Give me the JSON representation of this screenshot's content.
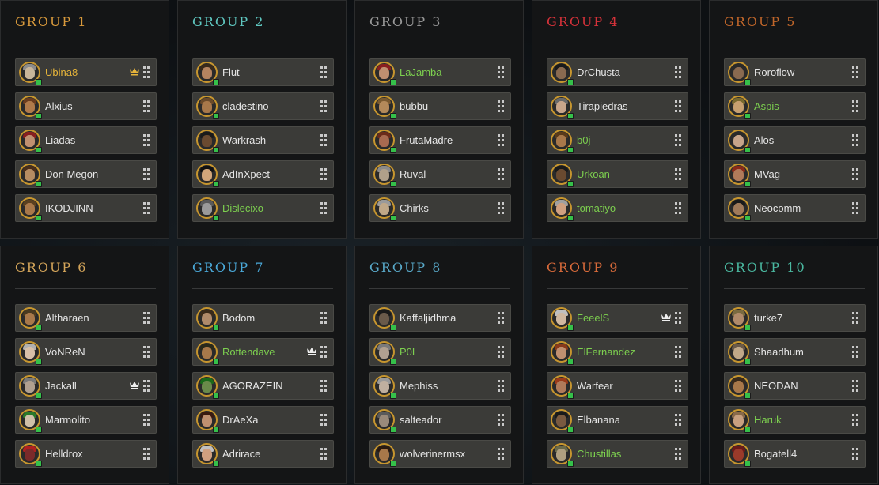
{
  "groups": [
    {
      "title": "GROUP 1",
      "color": "#d99a3c",
      "players": [
        {
          "name": "Ubina8",
          "name_color": "gold",
          "leader": true,
          "skin": "#c8b59a",
          "hair": "#8c8c8c",
          "ring": "#c7962f"
        },
        {
          "name": "Alxius",
          "skin": "#b07a4a",
          "hair": "#6b3d1f",
          "ring": "#c7962f"
        },
        {
          "name": "Liadas",
          "skin": "#c09070",
          "hair": "#8a1f1f",
          "ring": "#c7962f"
        },
        {
          "name": "Don Megon",
          "skin": "#b58c62",
          "hair": "#4a2e1a",
          "ring": "#c7962f"
        },
        {
          "name": "IKODJINN",
          "skin": "#a8784a",
          "hair": "#5a4020",
          "ring": "#c7962f"
        }
      ]
    },
    {
      "title": "GROUP 2",
      "color": "#5fc7c0",
      "players": [
        {
          "name": "Flut",
          "skin": "#b58460",
          "hair": "#3a2a1a",
          "ring": "#c7962f"
        },
        {
          "name": "cladestino",
          "skin": "#a8784a",
          "hair": "#6a4a2a",
          "ring": "#c7962f"
        },
        {
          "name": "Warkrash",
          "skin": "#6a4a30",
          "hair": "#1a1a1a",
          "ring": "#c7962f"
        },
        {
          "name": "AdInXpect",
          "skin": "#d2a67a",
          "hair": "#111111",
          "ring": "#c7962f"
        },
        {
          "name": "Dislecixo",
          "name_color": "green",
          "skin": "#9a9a9a",
          "hair": "#5a5a5a",
          "ring": "#c7962f"
        }
      ]
    },
    {
      "title": "GROUP 3",
      "color": "#9a9a9a",
      "players": [
        {
          "name": "LaJamba",
          "name_color": "green",
          "skin": "#c09070",
          "hair": "#8a1f1f",
          "ring": "#c7962f"
        },
        {
          "name": "bubbu",
          "skin": "#b48a5a",
          "hair": "#7a5a30",
          "ring": "#c7962f"
        },
        {
          "name": "FrutaMadre",
          "skin": "#a86a50",
          "hair": "#6a2a1a",
          "ring": "#c7962f"
        },
        {
          "name": "Ruval",
          "skin": "#b0a08a",
          "hair": "#8a8a8a",
          "ring": "#c7962f"
        },
        {
          "name": "Chirks",
          "skin": "#c0a888",
          "hair": "#9a9a9a",
          "ring": "#c7962f"
        }
      ]
    },
    {
      "title": "GROUP 4",
      "color": "#d8323a",
      "players": [
        {
          "name": "DrChusta",
          "skin": "#8a6a50",
          "hair": "#1a1a1a",
          "ring": "#c7962f"
        },
        {
          "name": "Tirapiedras",
          "skin": "#c8a58a",
          "hair": "#6a6a6a",
          "ring": "#c7962f"
        },
        {
          "name": "b0j",
          "name_color": "green",
          "skin": "#a8784a",
          "hair": "#5a3a1a",
          "ring": "#c7962f"
        },
        {
          "name": "Urkoan",
          "name_color": "green",
          "skin": "#6a4a30",
          "hair": "#1a1a1a",
          "ring": "#c7962f"
        },
        {
          "name": "tomatiyo",
          "name_color": "green",
          "skin": "#d0a080",
          "hair": "#a0a0a0",
          "ring": "#c7962f"
        }
      ]
    },
    {
      "title": "GROUP 5",
      "color": "#c0662a",
      "players": [
        {
          "name": "Roroflow",
          "skin": "#8a6a50",
          "hair": "#2a2a2a",
          "ring": "#c7962f"
        },
        {
          "name": "Aspis",
          "name_color": "green",
          "skin": "#c8a070",
          "hair": "#7a6a30",
          "ring": "#c7962f"
        },
        {
          "name": "Alos",
          "skin": "#c8a58a",
          "hair": "#2a2a2a",
          "ring": "#c7962f"
        },
        {
          "name": "MVag",
          "skin": "#b07a5a",
          "hair": "#8a2a1a",
          "ring": "#c7962f"
        },
        {
          "name": "Neocomm",
          "skin": "#a07a5a",
          "hair": "#1a1a1a",
          "ring": "#c7962f"
        }
      ]
    },
    {
      "title": "GROUP 6",
      "color": "#d4a55a",
      "players": [
        {
          "name": "Altharaen",
          "skin": "#a8784a",
          "hair": "#4a3a20",
          "ring": "#c7962f"
        },
        {
          "name": "VoNReN",
          "skin": "#d8c0a8",
          "hair": "#b0b0b0",
          "ring": "#c7962f"
        },
        {
          "name": "Jackall",
          "leader": true,
          "skin": "#b0a090",
          "hair": "#7a7a7a",
          "ring": "#c7962f"
        },
        {
          "name": "Marmolito",
          "skin": "#d0c0a8",
          "hair": "#2a7a2a",
          "ring": "#c7962f"
        },
        {
          "name": "Helldrox",
          "skin": "#7a2a2a",
          "hair": "#b02020",
          "ring": "#c7962f"
        }
      ]
    },
    {
      "title": "GROUP 7",
      "color": "#4aa8d8",
      "players": [
        {
          "name": "Bodom",
          "skin": "#b08a6a",
          "hair": "#3a2a1a",
          "ring": "#c7962f"
        },
        {
          "name": "Rottendave",
          "name_color": "green",
          "leader": true,
          "skin": "#a8784a",
          "hair": "#2a2a1a",
          "ring": "#c7962f"
        },
        {
          "name": "AGORAZEIN",
          "skin": "#6a8a4a",
          "hair": "#1a6a1a",
          "ring": "#c7962f"
        },
        {
          "name": "DrAeXa",
          "skin": "#c09070",
          "hair": "#3a1a10",
          "ring": "#c7962f"
        },
        {
          "name": "Adrirace",
          "skin": "#d0a080",
          "hair": "#c0c0c0",
          "ring": "#c7962f"
        }
      ]
    },
    {
      "title": "GROUP 8",
      "color": "#58a8c8",
      "players": [
        {
          "name": "Kaffaljidhma",
          "skin": "#6a5a4a",
          "hair": "#1a1a1a",
          "ring": "#c7962f"
        },
        {
          "name": "P0L",
          "name_color": "green",
          "skin": "#b0a090",
          "hair": "#7a7a7a",
          "ring": "#c7962f"
        },
        {
          "name": "Mephiss",
          "skin": "#c0b0a0",
          "hair": "#9a9a9a",
          "ring": "#c7962f"
        },
        {
          "name": "salteador",
          "skin": "#9a8a7a",
          "hair": "#5a5a5a",
          "ring": "#c7962f"
        },
        {
          "name": "wolverinermsx",
          "skin": "#a8784a",
          "hair": "#2a1a10",
          "ring": "#c7962f"
        }
      ]
    },
    {
      "title": "GROUP 9",
      "color": "#d86a3a",
      "players": [
        {
          "name": "FeeelS",
          "name_color": "green",
          "leader": true,
          "skin": "#d0b8a0",
          "hair": "#c0c0c0",
          "ring": "#c7962f"
        },
        {
          "name": "ElFernandez",
          "name_color": "green",
          "skin": "#c09070",
          "hair": "#8a3a1a",
          "ring": "#c7962f"
        },
        {
          "name": "Warfear",
          "skin": "#b07a5a",
          "hair": "#9a3a1a",
          "ring": "#c7962f"
        },
        {
          "name": "Elbanana",
          "skin": "#7a5a40",
          "hair": "#1a1a1a",
          "ring": "#c7962f"
        },
        {
          "name": "Chustillas",
          "name_color": "green",
          "skin": "#b0a080",
          "hair": "#6a6a4a",
          "ring": "#c7962f"
        }
      ]
    },
    {
      "title": "GROUP 10",
      "color": "#4ab8a0",
      "players": [
        {
          "name": "turke7",
          "skin": "#b08a6a",
          "hair": "#7a6a40",
          "ring": "#c7962f"
        },
        {
          "name": "Shaadhum",
          "skin": "#c0a888",
          "hair": "#6a5a4a",
          "ring": "#c7962f"
        },
        {
          "name": "NEODAN",
          "skin": "#a8784a",
          "hair": "#3a2a1a",
          "ring": "#c7962f"
        },
        {
          "name": "Haruk",
          "name_color": "green",
          "skin": "#c8a080",
          "hair": "#8a6a4a",
          "ring": "#c7962f"
        },
        {
          "name": "Bogatell4",
          "skin": "#9a3a2a",
          "hair": "#6a1a1a",
          "ring": "#c7962f"
        }
      ]
    }
  ]
}
